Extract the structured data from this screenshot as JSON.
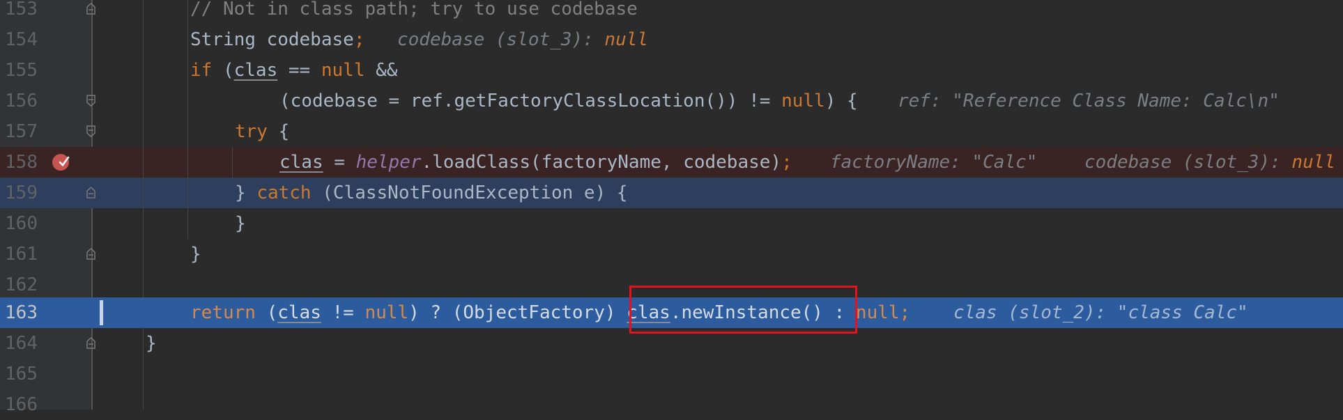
{
  "editor": {
    "lines": [
      {
        "number": "153",
        "code": "// Not in class path; try to use codebase"
      },
      {
        "number": "154",
        "code_a": "String codebase",
        "semicolon": ";",
        "hint_label": "codebase (slot_3): ",
        "hint_value": "null"
      },
      {
        "number": "155",
        "kw_if": "if",
        "code_a": " (",
        "var": "clas",
        "code_b": " == ",
        "kw_null": "null",
        "code_c": " &&"
      },
      {
        "number": "156",
        "code_a": "(codebase = ref.getFactoryClassLocation()) != ",
        "kw_null": "null",
        "code_b": ") {",
        "hint": "ref: \"Reference Class Name: Calc\\n\""
      },
      {
        "number": "157",
        "kw_try": "try",
        "code_a": " {"
      },
      {
        "number": "158",
        "var": "clas",
        "code_a": " = ",
        "field": "helper",
        "code_b": ".loadClass(factoryName, codebase)",
        "semicolon": ";",
        "hint_a": "factoryName: \"Calc\"",
        "hint_b_label": "codebase (slot_3): ",
        "hint_b_value": "null"
      },
      {
        "number": "159",
        "code_a": "} ",
        "kw_catch": "catch",
        "code_b": " (ClassNotFoundException e) {"
      },
      {
        "number": "160",
        "code": "}"
      },
      {
        "number": "161",
        "code": "}"
      },
      {
        "number": "162",
        "code": ""
      },
      {
        "number": "163",
        "kw_return": "return",
        "code_a": " (",
        "var": "clas",
        "code_b": " != ",
        "kw_null": "null",
        "code_c": ") ? (ObjectFactory) ",
        "var2": "clas",
        "code_d": ".newInstance() : ",
        "kw_null2": "null",
        "semicolon": ";",
        "hint": "clas (slot_2): \"class Calc\""
      },
      {
        "number": "164",
        "code": "}"
      },
      {
        "number": "165",
        "code": ""
      },
      {
        "number": "166",
        "code": ""
      }
    ]
  },
  "colors": {
    "background": "#2b2b2b",
    "gutter": "#313335",
    "keyword": "#cc7832",
    "field": "#9876aa",
    "comment": "#808080",
    "breakpoint_line": "#3a2323",
    "current_line": "#2d5c9e",
    "highlight_line": "#2d3f5c",
    "annotation_box": "#e0131e"
  },
  "icons": {
    "breakpoint": "breakpoint-verified-icon",
    "fold": "fold-marker-icon",
    "execution_point": "execution-point-marker"
  }
}
